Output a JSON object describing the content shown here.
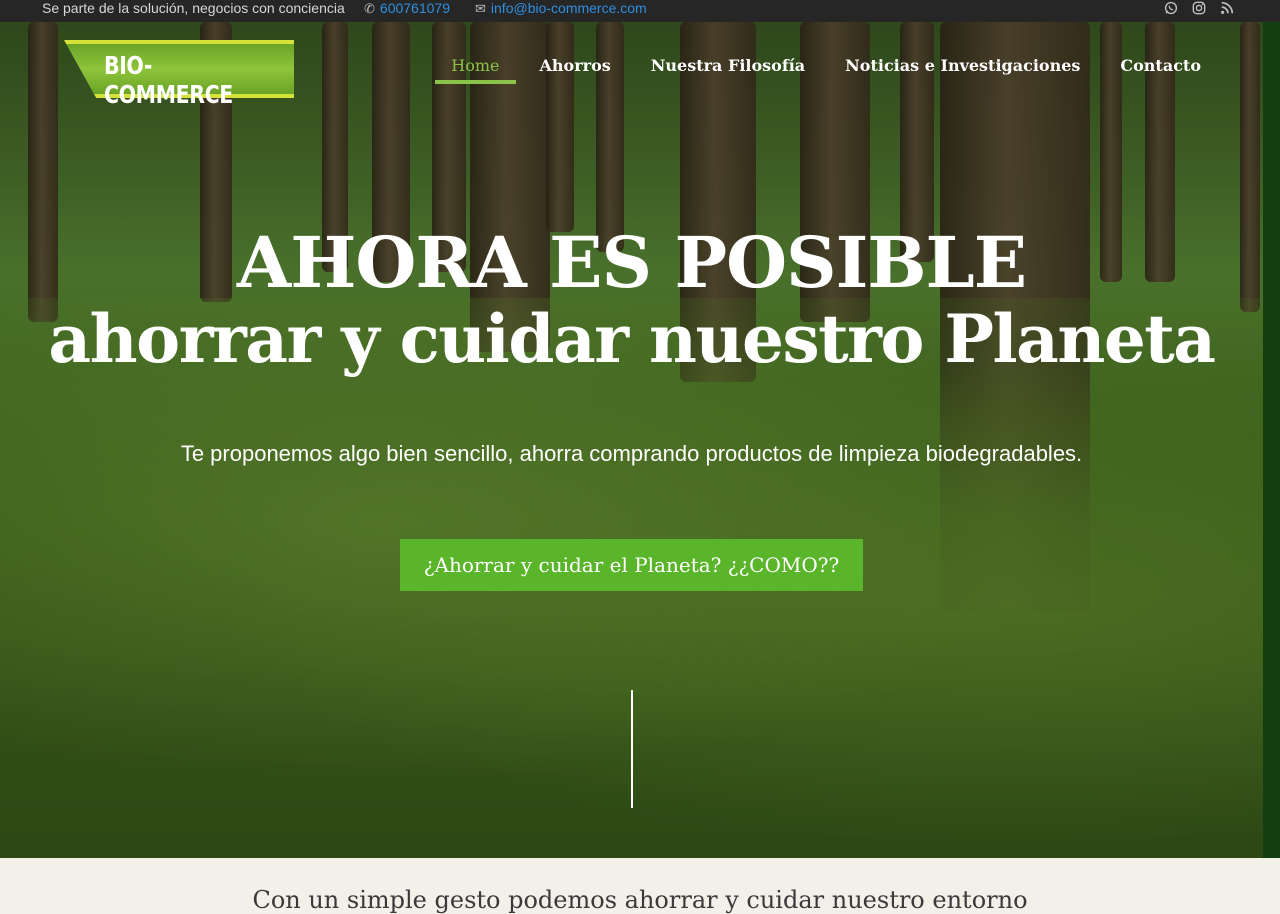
{
  "topbar": {
    "slogan": "Se parte de la solución, negocios con conciencia",
    "phone": "600761079",
    "email": "info@bio-commerce.com",
    "social": [
      "whatsapp-icon",
      "instagram-icon",
      "rss-icon"
    ]
  },
  "logo": {
    "text": "BIO-COMMERCE"
  },
  "nav": {
    "items": [
      "Home",
      "Ahorros",
      "Nuestra Filosofía",
      "Noticias e Investigaciones",
      "Contacto"
    ],
    "active": "Home"
  },
  "hero": {
    "title_line1": "AHORA ES POSIBLE",
    "title_line2": "ahorrar y cuidar nuestro Planeta",
    "lead": "Te proponemos algo bien sencillo, ahorra comprando productos de limpieza biodegradables.",
    "cta_label": "¿Ahorrar y cuidar el Planeta? ¿¿COMO??"
  },
  "section": {
    "heading": "Con un simple gesto podemos ahorrar y cuidar nuestro entorno"
  },
  "colors": {
    "accent": "#5ab52a",
    "nav_active": "#8bc34a",
    "link": "#2f8fe0",
    "topbar": "#262626"
  }
}
